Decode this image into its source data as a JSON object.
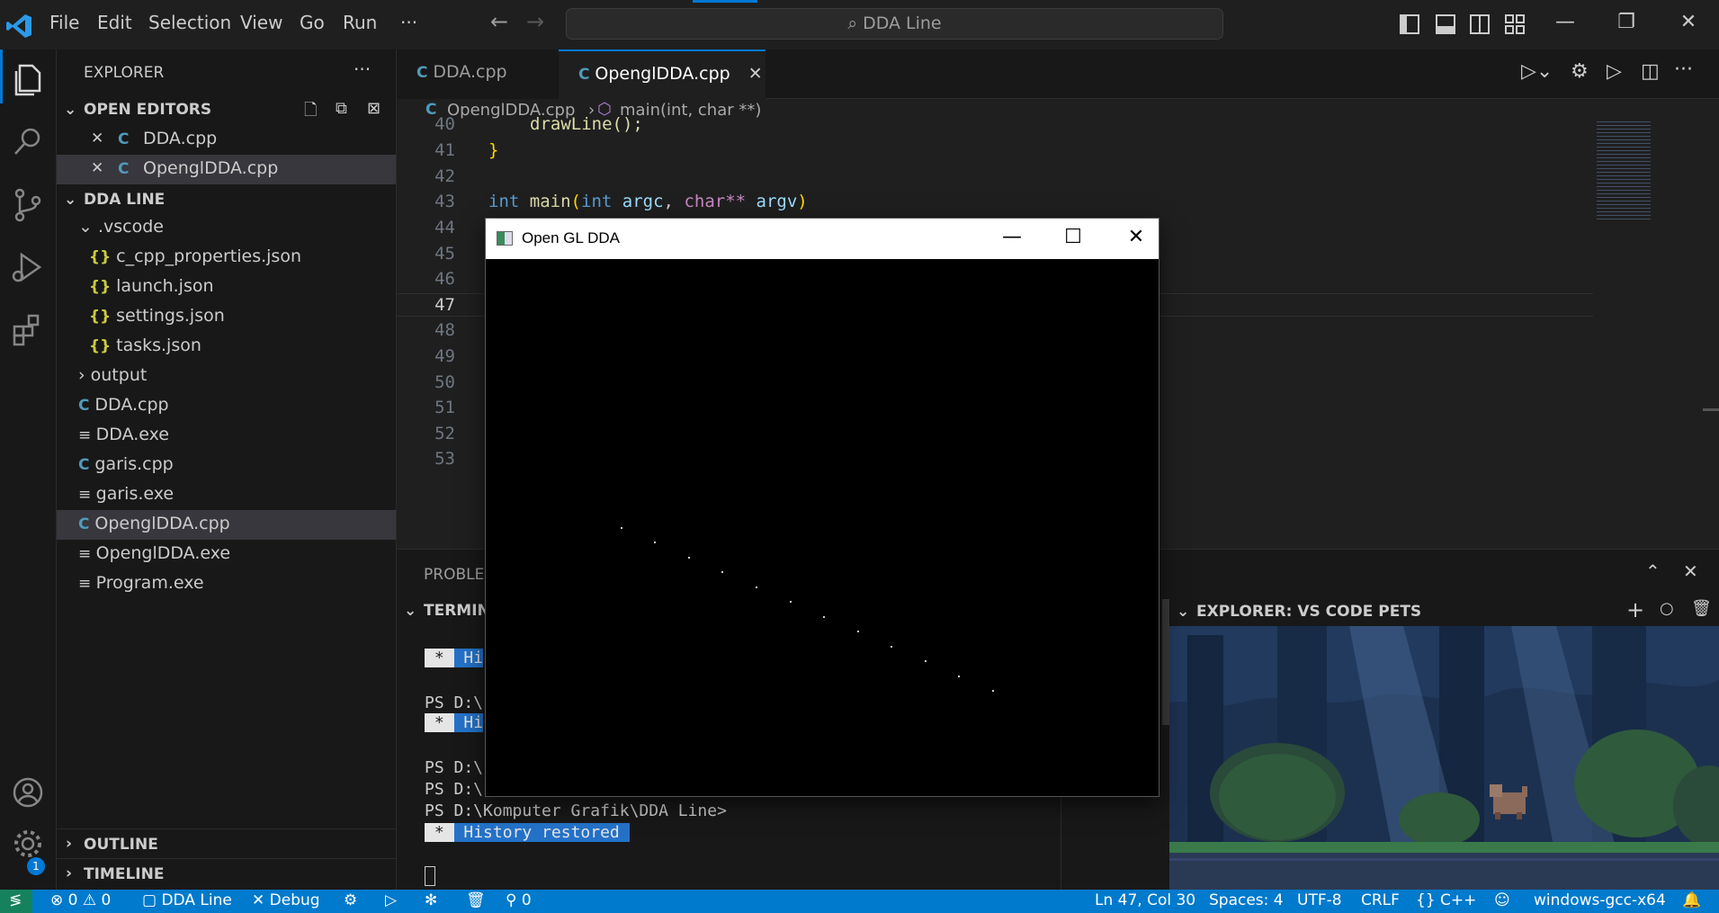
{
  "menu": [
    "File",
    "Edit",
    "Selection",
    "View",
    "Go",
    "Run",
    "···"
  ],
  "search": {
    "text": "DDA Line"
  },
  "sidebar": {
    "title": "EXPLORER",
    "open_editors_header": "OPEN EDITORS",
    "open_editors": [
      "DDA.cpp",
      "OpenglDDA.cpp"
    ],
    "project_header": "DDA LINE",
    "tree": [
      ".vscode",
      "c_cpp_properties.json",
      "launch.json",
      "settings.json",
      "tasks.json",
      "output",
      "DDA.cpp",
      "DDA.exe",
      "garis.cpp",
      "garis.exe",
      "OpenglDDA.cpp",
      "OpenglDDA.exe",
      "Program.exe"
    ],
    "outline_header": "OUTLINE",
    "timeline_header": "TIMELINE"
  },
  "tabs": [
    "DDA.cpp",
    "OpenglDDA.cpp"
  ],
  "breadcrumb": {
    "file": "OpenglDDA.cpp",
    "symbol": "main(int, char **)"
  },
  "editor": {
    "line_numbers": [
      "40",
      "41",
      "42",
      "43",
      "44",
      "45",
      "46",
      "47",
      "48",
      "49",
      "50",
      "51",
      "52",
      "53"
    ],
    "line40": "drawLine();",
    "line41": "}",
    "line43_kw": "int",
    "line43_fn": "main",
    "line43_p1_type": "int",
    "line43_p1": "argc",
    "line43_p2_type": "char**",
    "line43_p2": "argv"
  },
  "panel": {
    "problems_tab": "PROBLEMS",
    "terminal_header": "TERMINAL",
    "term_star": "*",
    "term_hist_short": "Hi",
    "term_prompt_short": "PS D:\\",
    "term_prompt_full": "PS D:\\Komputer Grafik\\DDA Line>",
    "term_history": "History restored"
  },
  "pets": {
    "header": "EXPLORER: VS CODE PETS"
  },
  "status": {
    "errors": "0",
    "warnings": "0",
    "folder": "DDA Line",
    "debug": "Debug",
    "ports": "0",
    "position": "Ln 47, Col 30",
    "spaces": "Spaces: 4",
    "encoding": "UTF-8",
    "eol": "CRLF",
    "language": "C++",
    "compiler": "windows-gcc-x64",
    "settings_badge": "1"
  },
  "glwindow": {
    "title": "Open GL DDA"
  },
  "colors": {
    "accent": "#0078d4",
    "statusbar": "#007acc",
    "terminal_highlight": "#2472c8"
  }
}
